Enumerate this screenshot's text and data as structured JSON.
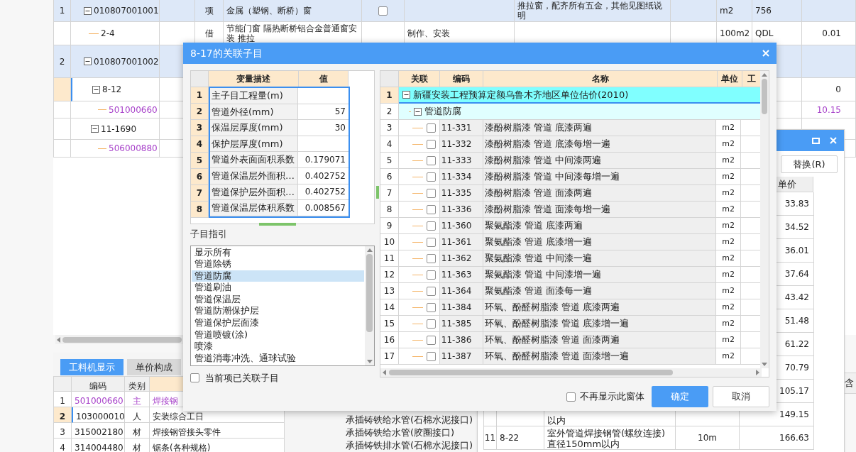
{
  "main_table": {
    "rows": [
      {
        "kind": "list_item",
        "number": "1",
        "code": "010807001001",
        "type": "项",
        "name": "金属（塑钢、断桥）窗",
        "checked": false,
        "description": "推拉窗，配齐所有五金，其他见图纸说明",
        "unit": "m2",
        "quantity": "756",
        "selected": false
      },
      {
        "kind": "quota",
        "code": "2-4",
        "type": "借",
        "name": "节能门窗 隔热断桥铝合金普通窗安装 推拉",
        "content": "制作、安装",
        "unit": "100m2",
        "quantity": "QDL",
        "value": "0.01",
        "selected": false
      },
      {
        "kind": "list_item",
        "number": "2",
        "code": "010807001002",
        "selected": false
      },
      {
        "kind": "quota_group",
        "code": "8-12",
        "value": "0",
        "selected": true
      },
      {
        "kind": "material",
        "code": "501000660",
        "value": "10.15",
        "selected": false
      },
      {
        "kind": "quota_group",
        "code": "11-1690",
        "selected": false
      },
      {
        "kind": "material",
        "code": "506000880",
        "selected": false
      }
    ]
  },
  "bottom_panel": {
    "tabs": [
      {
        "label": "工料机显示",
        "selected": true
      },
      {
        "label": "单价构成",
        "selected": false
      }
    ],
    "columns": [
      "编码",
      "类别"
    ],
    "rows": [
      {
        "number": "1",
        "code": "501000660",
        "category": "主",
        "name": "焊接钢",
        "kind": "main",
        "selected": false
      },
      {
        "number": "2",
        "code": "103000010",
        "category": "人",
        "name": "安装综合工日",
        "kind": "normal",
        "selected": true
      },
      {
        "number": "3",
        "code": "315002180",
        "category": "材",
        "name": "焊接钢管接头零件",
        "kind": "normal",
        "selected": false
      },
      {
        "number": "4",
        "code": "314004480",
        "category": "材",
        "name": "锯条(各种规格)",
        "kind": "normal",
        "selected": false
      }
    ]
  },
  "material_list": [
    "承插铸铁给水管(石棉水泥接口)",
    "承插铸铁给水管(胶圈接口)",
    "承插铸铁排水管(石棉水泥接口)"
  ],
  "edge_header": "含",
  "replace_dialog": {
    "button": "替换(R)",
    "price_header": "单价",
    "rows": [
      {
        "price": "33.83"
      },
      {
        "price": "34.52"
      },
      {
        "price": "36.01"
      },
      {
        "price": "37.64"
      },
      {
        "price": "43.42"
      },
      {
        "price": "51.48"
      },
      {
        "price": "61.22"
      },
      {
        "price": "70.79"
      },
      {
        "price": "105.17"
      },
      {
        "name": "以内",
        "price": "149.15"
      },
      {
        "number": "11",
        "code": "8-22",
        "name": "室外管道焊接钢管(螺纹连接) 直径150mm以内",
        "unit": "10m",
        "price": "166.63"
      }
    ]
  },
  "dialog": {
    "title": "8-17的关联子目",
    "variables": {
      "columns": [
        "变量描述",
        "值"
      ],
      "rows": [
        {
          "number": "1",
          "description": "主子目工程量(m)"
        },
        {
          "number": "2",
          "description": "管道外径(mm)",
          "value": "57"
        },
        {
          "number": "3",
          "description": "保温层厚度(mm)",
          "value": "30"
        },
        {
          "number": "4",
          "description": "保护层厚度(mm)"
        },
        {
          "number": "5",
          "description": "管道外表面面积系数",
          "value": "0.179071"
        },
        {
          "number": "6",
          "description": "管道保温层外面积…",
          "value": "0.402752"
        },
        {
          "number": "7",
          "description": "管道保护层外面积…",
          "value": "0.402752"
        },
        {
          "number": "8",
          "description": "管道保温层体积系数",
          "value": "0.008567"
        }
      ]
    },
    "guide_label": "子目指引",
    "guide_items": [
      {
        "label": "显示所有",
        "selected": false
      },
      {
        "label": "管道除锈",
        "selected": false
      },
      {
        "label": "管道防腐",
        "selected": true
      },
      {
        "label": "管道刷油",
        "selected": false
      },
      {
        "label": "管道保温层",
        "selected": false
      },
      {
        "label": "管道防潮保护层",
        "selected": false
      },
      {
        "label": "管道保护层面漆",
        "selected": false
      },
      {
        "label": "管道喷镀(涂)",
        "selected": false
      },
      {
        "label": "喷漆",
        "selected": false
      },
      {
        "label": "管道消毒冲洗、通球试验",
        "selected": false
      }
    ],
    "linked_only": {
      "label": "当前项已关联子目",
      "checked": false
    },
    "items_table": {
      "columns": [
        "关联",
        "编码",
        "名称",
        "单位",
        "工"
      ],
      "rows": [
        {
          "number": "1",
          "kind": "root",
          "name": "新疆安装工程预算定额乌鲁木齐地区单位估价(2010)",
          "selected": true
        },
        {
          "number": "2",
          "kind": "group",
          "name": "管道防腐",
          "selected": false
        },
        {
          "number": "3",
          "kind": "item",
          "checked": false,
          "code": "11-331",
          "name": "漆酚树脂漆 管道 底漆两遍",
          "unit": "m2",
          "selected": false
        },
        {
          "number": "4",
          "kind": "item",
          "checked": false,
          "code": "11-332",
          "name": "漆酚树脂漆 管道 底漆每增一遍",
          "unit": "m2",
          "selected": false
        },
        {
          "number": "5",
          "kind": "item",
          "checked": false,
          "code": "11-333",
          "name": "漆酚树脂漆 管道 中间漆两遍",
          "unit": "m2",
          "selected": false
        },
        {
          "number": "6",
          "kind": "item",
          "checked": false,
          "code": "11-334",
          "name": "漆酚树脂漆 管道 中间漆每增一遍",
          "unit": "m2",
          "selected": false
        },
        {
          "number": "7",
          "kind": "item",
          "checked": false,
          "code": "11-335",
          "name": "漆酚树脂漆 管道 面漆两遍",
          "unit": "m2",
          "selected": false
        },
        {
          "number": "8",
          "kind": "item",
          "checked": false,
          "code": "11-336",
          "name": "漆酚树脂漆 管道 面漆每增一遍",
          "unit": "m2",
          "selected": false
        },
        {
          "number": "9",
          "kind": "item",
          "checked": false,
          "code": "11-360",
          "name": "聚氨酯漆 管道 底漆两遍",
          "unit": "m2",
          "selected": false
        },
        {
          "number": "10",
          "kind": "item",
          "checked": false,
          "code": "11-361",
          "name": "聚氨酯漆 管道 底漆增一遍",
          "unit": "m2",
          "selected": false
        },
        {
          "number": "11",
          "kind": "item",
          "checked": false,
          "code": "11-362",
          "name": "聚氨酯漆 管道 中间漆一遍",
          "unit": "m2",
          "selected": false
        },
        {
          "number": "12",
          "kind": "item",
          "checked": false,
          "code": "11-363",
          "name": "聚氨酯漆 管道 中间漆增一遍",
          "unit": "m2",
          "selected": false
        },
        {
          "number": "13",
          "kind": "item",
          "checked": false,
          "code": "11-364",
          "name": "聚氨酯漆 管道 面漆每一遍",
          "unit": "m2",
          "selected": false
        },
        {
          "number": "14",
          "kind": "item",
          "checked": false,
          "code": "11-384",
          "name": "环氧、酚醛树脂漆 管道 底漆两遍",
          "unit": "m2",
          "selected": false
        },
        {
          "number": "15",
          "kind": "item",
          "checked": false,
          "code": "11-385",
          "name": "环氧、酚醛树脂漆 管道 底漆增一遍",
          "unit": "m2",
          "selected": false
        },
        {
          "number": "16",
          "kind": "item",
          "checked": false,
          "code": "11-386",
          "name": "环氧、酚醛树脂漆 管道 面漆两遍",
          "unit": "m2",
          "selected": false
        },
        {
          "number": "17",
          "kind": "item",
          "checked": false,
          "code": "11-387",
          "name": "环氧、酚醛树脂漆 管道 面漆增一遍",
          "unit": "m2",
          "selected": false
        }
      ]
    },
    "dont_show": {
      "label": "不再显示此窗体",
      "checked": false
    },
    "buttons": [
      {
        "label": "确定",
        "primary": true
      },
      {
        "label": "取消",
        "primary": false
      }
    ]
  }
}
